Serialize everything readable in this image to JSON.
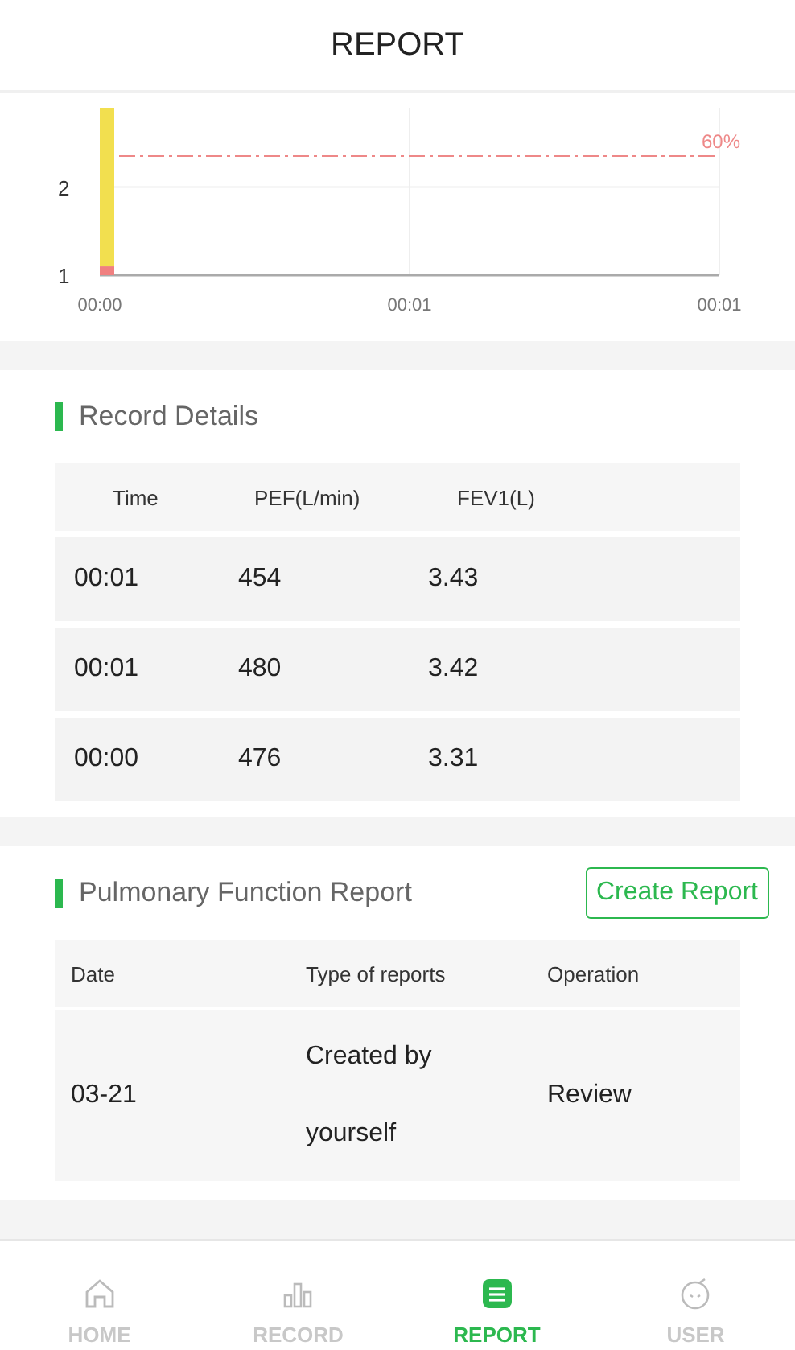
{
  "header": {
    "title": "REPORT"
  },
  "trend": {
    "chart_data": {
      "type": "bar",
      "stacked": true,
      "categories": [
        "00:00",
        "00:01",
        "00:01"
      ],
      "series": [
        {
          "color": "#f08080",
          "values": [
            1.1,
            null,
            null
          ]
        },
        {
          "color": "#f2df4f",
          "values": [
            1.8,
            null,
            null
          ]
        }
      ],
      "ylim": [
        1,
        2.9
      ],
      "yticks": [
        1,
        2
      ]
    },
    "threshold_label": "60%"
  },
  "record_details": {
    "title": "Record Details",
    "columns": [
      "Time",
      "PEF(L/min)",
      "FEV1(L)"
    ],
    "rows": [
      [
        "00:01",
        "454",
        "3.43"
      ],
      [
        "00:01",
        "480",
        "3.42"
      ],
      [
        "00:00",
        "476",
        "3.31"
      ]
    ]
  },
  "pulmonary_report": {
    "title": "Pulmonary Function Report",
    "button": "Create Report",
    "columns": [
      "Date",
      "Type of reports",
      "Operation"
    ],
    "rows": [
      {
        "date": "03-21",
        "type_lines": [
          "Created by",
          "yourself"
        ],
        "operation": "Review"
      }
    ]
  },
  "tab_bar": [
    {
      "label": "HOME",
      "kind": "home",
      "selected": false
    },
    {
      "label": "RECORD",
      "kind": "stats",
      "selected": false
    },
    {
      "label": "REPORT",
      "kind": "report",
      "selected": true
    },
    {
      "label": "USER",
      "kind": "user",
      "selected": false
    }
  ]
}
